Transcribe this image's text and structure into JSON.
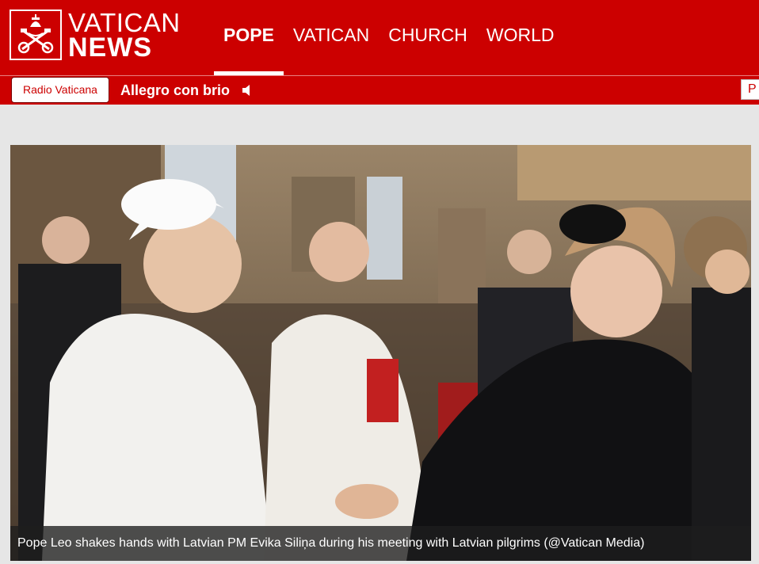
{
  "header": {
    "logo": {
      "line1": "VATICAN",
      "line2": "NEWS",
      "icon": "papal-keys-icon"
    },
    "nav": [
      {
        "label": "POPE",
        "active": true
      },
      {
        "label": "VATICAN",
        "active": false
      },
      {
        "label": "CHURCH",
        "active": false
      },
      {
        "label": "WORLD",
        "active": false
      }
    ]
  },
  "radio": {
    "button_label": "Radio Vaticana",
    "now_playing": "Allegro con brio",
    "speaker_icon": "speaker-icon",
    "right_box_label": "P"
  },
  "photo": {
    "caption": "Pope Leo shakes hands with Latvian PM Evika Siliņa during his meeting with Latvian pilgrims  (@Vatican Media)"
  },
  "colors": {
    "brand_red": "#cc0000",
    "page_bg": "#e6e6e6"
  }
}
